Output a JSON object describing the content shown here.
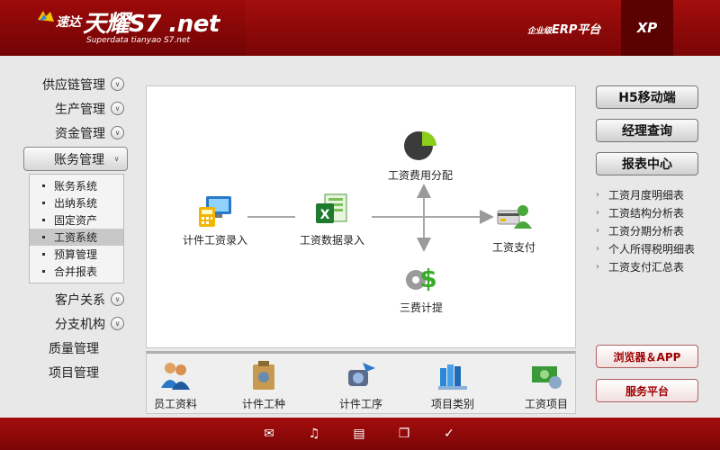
{
  "header": {
    "logo_cn": "速达",
    "logo_brand": "天耀S7 .net",
    "logo_sub": "Superdata tianyao S7.net",
    "erp_small": "企业级",
    "erp_label": "ERP平台",
    "xp": "XP"
  },
  "sidebar": {
    "items": [
      {
        "label": "供应链管理"
      },
      {
        "label": "生产管理"
      },
      {
        "label": "资金管理"
      },
      {
        "label": "账务管理"
      },
      {
        "label": "客户关系"
      },
      {
        "label": "分支机构"
      },
      {
        "label": "质量管理"
      },
      {
        "label": "项目管理"
      }
    ],
    "submenu": [
      {
        "label": "账务系统"
      },
      {
        "label": "出纳系统"
      },
      {
        "label": "固定资产"
      },
      {
        "label": "工资系统"
      },
      {
        "label": "预算管理"
      },
      {
        "label": "合并报表"
      }
    ]
  },
  "flow": {
    "piece_entry": "计件工资录入",
    "data_entry": "工资数据录入",
    "allocation": "工资费用分配",
    "payment": "工资支付",
    "three_fees": "三费计提"
  },
  "tools": [
    {
      "label": "员工资料"
    },
    {
      "label": "计件工种"
    },
    {
      "label": "计件工序"
    },
    {
      "label": "项目类别"
    },
    {
      "label": "工资项目"
    }
  ],
  "right": {
    "buttons": [
      "H5移动端",
      "经理查询",
      "报表中心"
    ],
    "reports": [
      "工资月度明细表",
      "工资结构分析表",
      "工资分期分析表",
      "个人所得税明细表",
      "工资支付汇总表"
    ],
    "browser_app": "浏览器＆APP",
    "service": "服务平台"
  },
  "colors": {
    "header_red": "#8a0808",
    "accent_green": "#7ab800",
    "accent_blue": "#2a78c8"
  }
}
